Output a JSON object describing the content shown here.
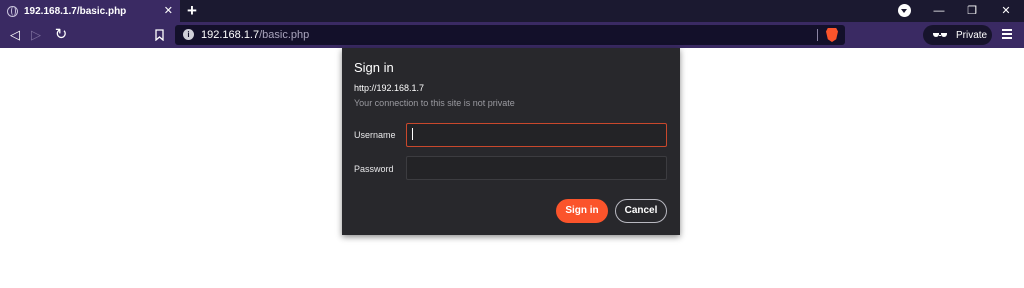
{
  "browser": {
    "tab": {
      "title": "192.168.1.7/basic.php",
      "close_glyph": "✕"
    },
    "new_tab_glyph": "+",
    "window_controls": {
      "minimize": "—",
      "restore": "❐",
      "close": "✕"
    },
    "nav": {
      "back": "◁",
      "forward": "▷",
      "reload": "↻",
      "bookmark": "🔖"
    },
    "address": {
      "host": "192.168.1.7",
      "path": "/basic.php",
      "info_glyph": "i"
    },
    "private_label": "Private",
    "icons": {
      "favicon": "globe-icon",
      "profile": "profile-dropdown-icon",
      "shield": "brave-shield-icon",
      "private": "private-glasses-icon",
      "menu": "hamburger-menu-icon"
    },
    "colors": {
      "tabstrip": "#1b1930",
      "toolbar": "#3a2a63",
      "urlbar": "#13102a",
      "accent": "#fb542b"
    }
  },
  "dialog": {
    "title": "Sign in",
    "origin": "http://192.168.1.7",
    "warning": "Your connection to this site is not private",
    "username_label": "Username",
    "username_value": "",
    "password_label": "Password",
    "password_value": "",
    "signin_label": "Sign in",
    "cancel_label": "Cancel",
    "colors": {
      "background": "#28282c",
      "primary_button": "#fb542b",
      "focus_border": "#c9482c"
    }
  }
}
